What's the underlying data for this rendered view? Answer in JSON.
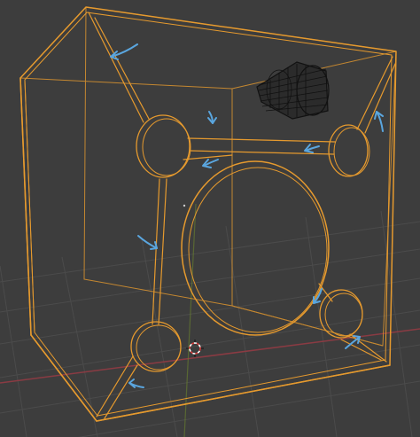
{
  "viewport": {
    "editor": "3D Viewport",
    "background_color": "#3d3d3d",
    "grid_color": "#4b4b4b",
    "axis_x_color": "#8a3b43",
    "axis_y_color": "#6f8a2c"
  },
  "scene_object": {
    "type": "speaker-cabinet-wireframe",
    "selected": true,
    "outline_color": "#e69a2e",
    "cylinder_color": "#111111"
  },
  "annotations": {
    "arrow_color": "#5aa6df",
    "arrow_count": 10
  },
  "cursor": {
    "icon": "3d-cursor-icon",
    "colors": [
      "#d63a3a",
      "#ffffff"
    ]
  }
}
